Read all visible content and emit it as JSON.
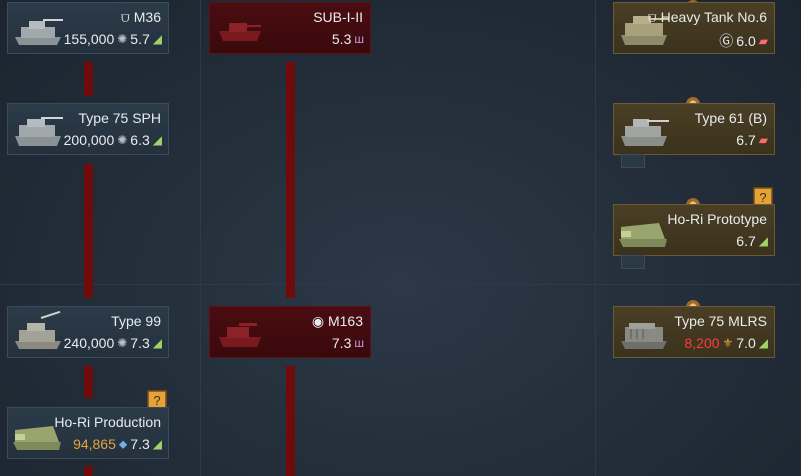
{
  "cards": {
    "m36": {
      "name": "M36",
      "price": "155,000",
      "br": "5.7"
    },
    "sub": {
      "name": "SUB-I-II",
      "br": "5.3"
    },
    "ht6": {
      "name": "Heavy Tank No.6",
      "br": "6.0"
    },
    "type75sph": {
      "name": "Type 75 SPH",
      "price": "200,000",
      "br": "6.3"
    },
    "type61b": {
      "name": "Type 61 (B)",
      "br": "6.7"
    },
    "horiproto": {
      "name": "Ho-Ri Prototype",
      "br": "6.7",
      "badge": "?"
    },
    "type99": {
      "name": "Type 99",
      "price": "240,000",
      "br": "7.3"
    },
    "m163": {
      "name": "M163",
      "br": "7.3"
    },
    "type75mlrs": {
      "name": "Type 75 MLRS",
      "price": "8,200",
      "br": "7.0"
    },
    "horiprod": {
      "name": "Ho-Ri Production",
      "price": "94,865",
      "br": "7.3",
      "badge": "?"
    }
  },
  "colors": {
    "background": "#222d39",
    "link": "#6f0b0b",
    "locked_card": "#4a0d11",
    "premium_card": "#4a3f25",
    "price_red": "#ff3b3b",
    "price_gold": "#e3a33a",
    "ground_icon": "#9fd36a",
    "air_icon": "#c79be0"
  }
}
